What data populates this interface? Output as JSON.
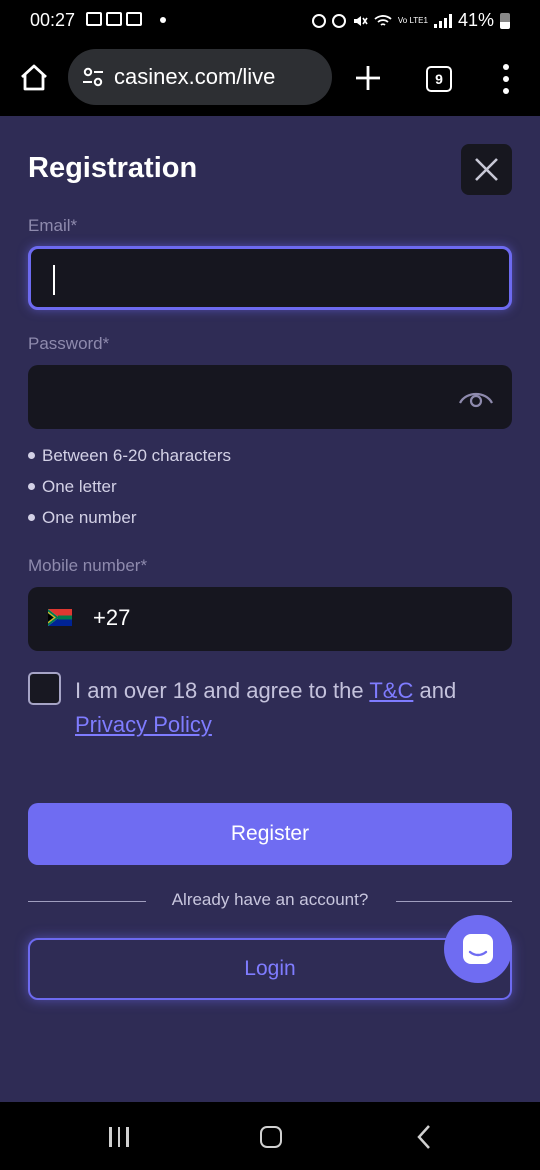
{
  "status_bar": {
    "time": "00:27",
    "battery": "41%",
    "network": "Vo LTE1"
  },
  "browser": {
    "url": "casinex.com/live",
    "tab_count": "9"
  },
  "form": {
    "title": "Registration",
    "email_label": "Email*",
    "email_value": "",
    "password_label": "Password*",
    "password_rules": [
      "Between 6-20 characters",
      "One letter",
      "One number"
    ],
    "mobile_label": "Mobile number*",
    "country_code": "+27",
    "agree_text": "I am over 18 and agree to the ",
    "tc_link": "T&C",
    "and_text": " and ",
    "privacy_link": "Privacy Policy",
    "register_label": "Register",
    "divider_text": "Already have an account?",
    "login_label": "Login"
  },
  "colors": {
    "page_bg": "#2f2c55",
    "field_bg": "#16161f",
    "accent": "#6f6cf2",
    "link": "#7f7cff"
  },
  "icons": [
    "home-icon",
    "site-settings-icon",
    "plus-icon",
    "tabs-icon",
    "more-vert-icon",
    "close-icon",
    "eye-icon",
    "south-africa-flag-icon",
    "chat-icon",
    "recents-icon",
    "home-nav-icon",
    "back-icon"
  ]
}
